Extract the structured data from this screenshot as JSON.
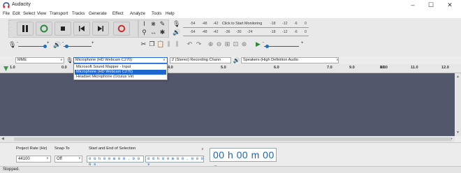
{
  "window": {
    "title": "Audacity",
    "minimize": "–",
    "maximize": "☐",
    "close": "✕"
  },
  "menu": [
    "File",
    "Edit",
    "Select",
    "View",
    "Transport",
    "Tracks",
    "Generate",
    "Effect",
    "Analyze",
    "Tools",
    "Help"
  ],
  "meters": {
    "record_scale": [
      "-54",
      "-48",
      "-42",
      "-18",
      "-12",
      "-6",
      "0"
    ],
    "record_message": "Click to Start Monitoring",
    "play_scale": [
      "-54",
      "-48",
      "-42",
      "-36",
      "-30",
      "-24",
      "-18",
      "-12",
      "-6",
      "0"
    ],
    "record_scale_head": [
      "-54",
      "-48",
      "-42"
    ],
    "record_scale_tail": [
      "-18",
      "-12",
      "-6",
      "0"
    ]
  },
  "sliders": {
    "record_minus": "-",
    "record_plus": "+",
    "play_minus": "-",
    "play_plus": "+",
    "speed_minus": "-",
    "speed_plus": "+"
  },
  "device": {
    "host": "MME",
    "input": "Microphone (HD Webcam C270)",
    "channels": "2 (Stereo) Recording Chann",
    "output": "Speakers (High Definition Audio"
  },
  "input_options": [
    "Microsoft Sound Mapper - Input",
    "Microphone (HD Webcam C270)",
    "Headset Microphone (Oculus Virt"
  ],
  "ruler": {
    "labels": [
      "1.0",
      "0.0",
      "4.0",
      "5.0",
      "6.0",
      "7.0",
      "8.0",
      "9.0",
      "10.0",
      "11.0",
      "12.0"
    ]
  },
  "selection": {
    "rate_label": "Project Rate (Hz)",
    "rate_value": "44100",
    "snap_label": "Snap-To",
    "snap_value": "Off",
    "mode": "Start and End of Selection",
    "start_time": "0 0 h 0 0 m 0 0 . 0 0 0 s",
    "end_time": "0 0 h 0 0 m 0 0 . 0 0 0 s",
    "big_time": "00 h 00 m 00 s"
  },
  "status": "Stopped."
}
